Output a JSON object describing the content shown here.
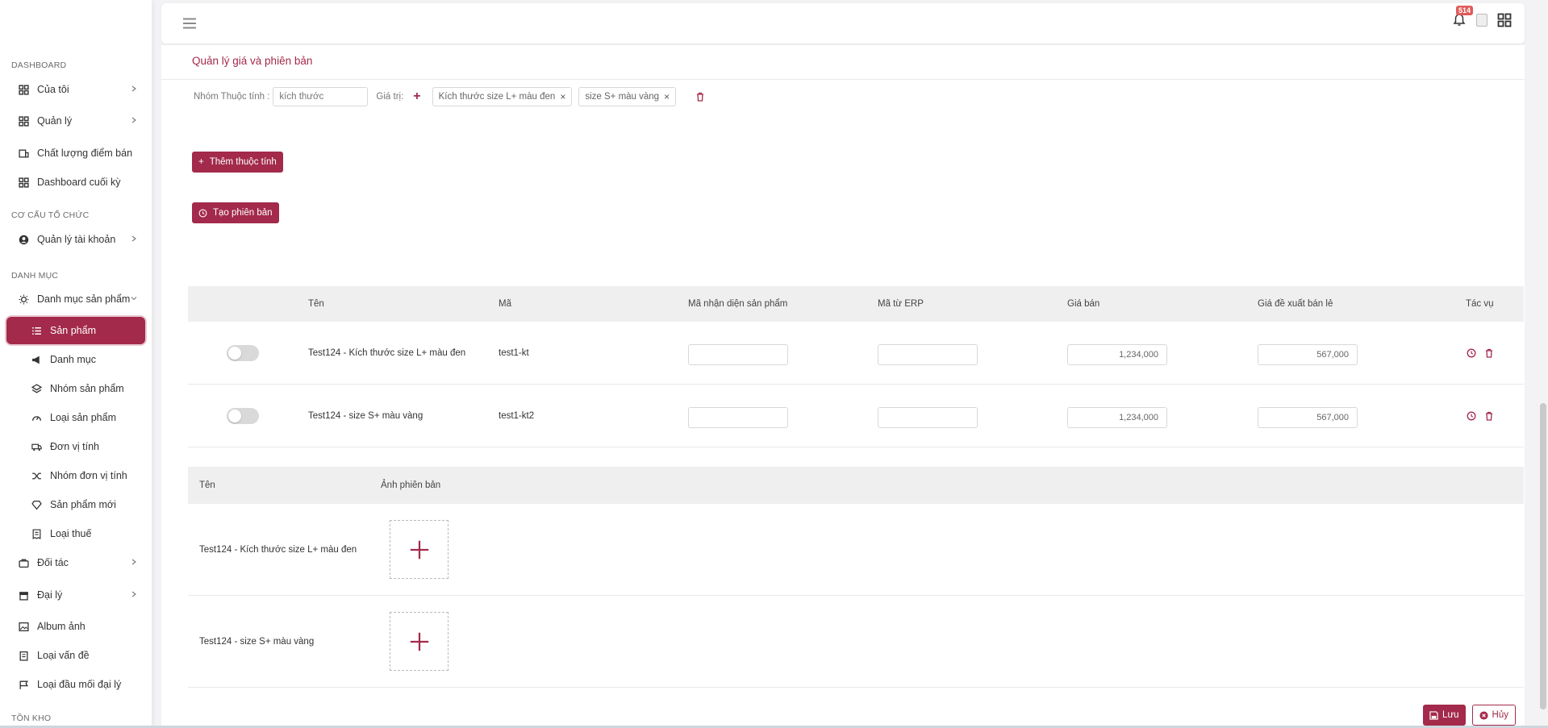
{
  "sidebar": {
    "sections": {
      "dashboard": "DASHBOARD",
      "org": "CƠ CẤU TỔ CHỨC",
      "catalog": "DANH MỤC",
      "inventory": "TỒN KHO"
    },
    "items": {
      "cua_toi": "Của tôi",
      "quan_ly": "Quản lý",
      "chat_luong": "Chất lượng điểm bán",
      "dashboard_cuoi_ky": "Dashboard cuối kỳ",
      "quan_ly_tai_khoan": "Quản lý tài khoản",
      "danh_muc_sp": "Danh mục sản phẩm",
      "san_pham": "Sản phẩm",
      "danh_muc": "Danh mục",
      "nhom_sp": "Nhóm sản phẩm",
      "loai_sp": "Loại sản phẩm",
      "don_vi_tinh": "Đơn vị tính",
      "nhom_dvt": "Nhóm đơn vị tính",
      "sp_moi": "Sản phẩm mới",
      "loai_thue": "Loại thuế",
      "doi_tac": "Đối tác",
      "dai_ly": "Đại lý",
      "album_anh": "Album ảnh",
      "loai_van_de": "Loại vấn đề",
      "loai_dau_moi": "Loại đầu mối đại lý"
    }
  },
  "header": {
    "notif_count": "514"
  },
  "page": {
    "title": "Quản lý giá và phiên bản",
    "attr_group_label": "Nhóm Thuộc tính :",
    "attr_group_value": "kích thước",
    "value_label": "Giá trị:",
    "tags": [
      "Kích thước size L+ màu đen",
      "size S+ màu vàng"
    ],
    "add_attr_btn": "Thêm thuộc tính",
    "create_version_btn": "Tạo phiên bản"
  },
  "variants_table": {
    "headers": [
      "Tên",
      "Mã",
      "Mã nhận diện sản phẩm",
      "Mã từ ERP",
      "Giá bán",
      "Giá đề xuất bán lẻ",
      "Tác vụ"
    ],
    "rows": [
      {
        "name": "Test124 - Kích thước size L+ màu đen",
        "code": "test1-kt",
        "barcode": "",
        "erp": "",
        "price": "1,234,000",
        "retail": "567,000",
        "enabled": false
      },
      {
        "name": "Test124 - size S+ màu vàng",
        "code": "test1-kt2",
        "barcode": "",
        "erp": "",
        "price": "1,234,000",
        "retail": "567,000",
        "enabled": false
      }
    ]
  },
  "images_table": {
    "headers": [
      "Tên",
      "Ảnh phiên bản"
    ],
    "rows": [
      {
        "name": "Test124 - Kích thước size L+ màu đen"
      },
      {
        "name": "Test124 - size S+ màu vàng"
      }
    ]
  },
  "footer": {
    "save": "Lưu",
    "cancel": "Hủy"
  },
  "colors": {
    "accent": "#a32a4a"
  }
}
